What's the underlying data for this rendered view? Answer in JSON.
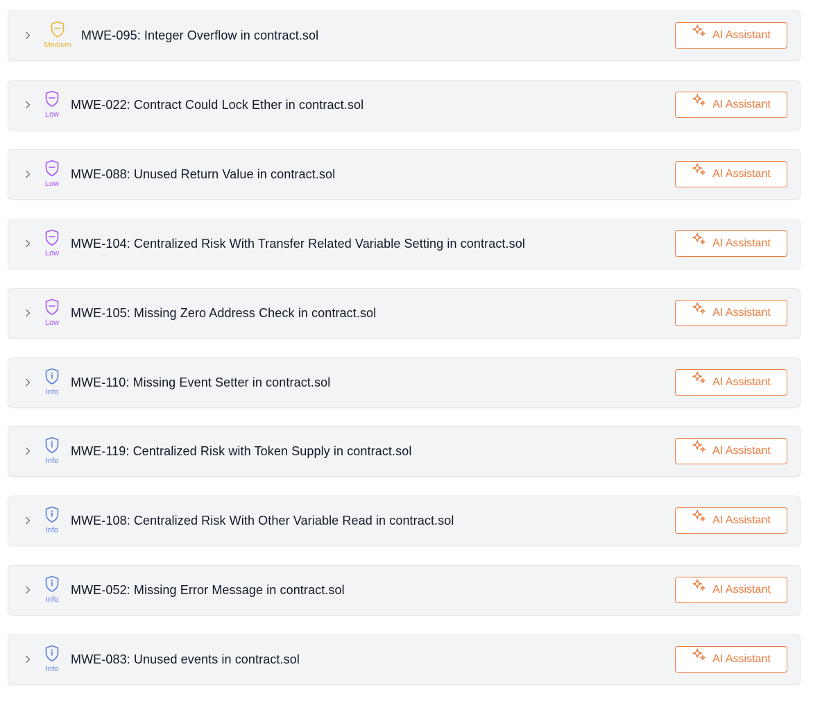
{
  "severity_styles": {
    "medium": {
      "color": "#e8b52f",
      "icon": "shield-minus-icon"
    },
    "low": {
      "color": "#a855f7",
      "icon": "shield-minus-icon"
    },
    "info": {
      "color": "#5b7fdb",
      "icon": "shield-info-icon"
    }
  },
  "accent_color": "#ea7a3a",
  "issues": [
    {
      "severity": "medium",
      "severity_label": "Medium",
      "title": "MWE-095: Integer Overflow in contract.sol",
      "action_label": "AI Assistant"
    },
    {
      "severity": "low",
      "severity_label": "Low",
      "title": "MWE-022: Contract Could Lock Ether in contract.sol",
      "action_label": "AI Assistant"
    },
    {
      "severity": "low",
      "severity_label": "Low",
      "title": "MWE-088: Unused Return Value in contract.sol",
      "action_label": "AI Assistant"
    },
    {
      "severity": "low",
      "severity_label": "Low",
      "title": "MWE-104: Centralized Risk With Transfer Related Variable Setting in contract.sol",
      "action_label": "AI Assistant"
    },
    {
      "severity": "low",
      "severity_label": "Low",
      "title": "MWE-105: Missing Zero Address Check in contract.sol",
      "action_label": "AI Assistant"
    },
    {
      "severity": "info",
      "severity_label": "Info",
      "title": "MWE-110: Missing Event Setter in contract.sol",
      "action_label": "AI Assistant"
    },
    {
      "severity": "info",
      "severity_label": "Info",
      "title": "MWE-119: Centralized Risk with Token Supply in contract.sol",
      "action_label": "AI Assistant"
    },
    {
      "severity": "info",
      "severity_label": "Info",
      "title": "MWE-108: Centralized Risk With Other Variable Read in contract.sol",
      "action_label": "AI Assistant"
    },
    {
      "severity": "info",
      "severity_label": "Info",
      "title": "MWE-052: Missing Error Message in contract.sol",
      "action_label": "AI Assistant"
    },
    {
      "severity": "info",
      "severity_label": "Info",
      "title": "MWE-083: Unused events in contract.sol",
      "action_label": "AI Assistant"
    }
  ]
}
